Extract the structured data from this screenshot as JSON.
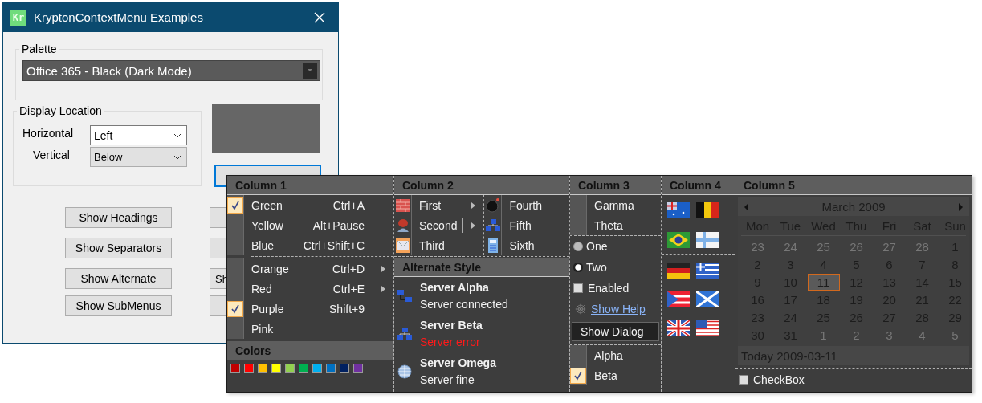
{
  "window": {
    "app_icon_text": "Kr",
    "title": "KryptonContextMenu Examples",
    "palette": {
      "label": "Palette",
      "value": "Office 365 - Black (Dark Mode)"
    },
    "display_location": {
      "label": "Display Location",
      "horizontal": {
        "label": "Horizontal",
        "value": "Left"
      },
      "vertical": {
        "label": "Vertical",
        "value": "Below"
      }
    },
    "left_buttons": [
      "Show Headings",
      "Show Separators",
      "Show Alternate",
      "Show SubMenus"
    ],
    "covered_button_label": "Sh"
  },
  "menu": {
    "column_1": {
      "heading": "Column 1",
      "items": [
        {
          "text": "Green",
          "shortcut": "Ctrl+A",
          "checked": true,
          "submenu": false,
          "separator_before": false
        },
        {
          "text": "Yellow",
          "shortcut": "Alt+Pause",
          "checked": false,
          "submenu": false,
          "separator_before": false
        },
        {
          "text": "Blue",
          "shortcut": "Ctrl+Shift+C",
          "checked": false,
          "submenu": false,
          "separator_before": false
        },
        {
          "text": "Orange",
          "shortcut": "Ctrl+D",
          "checked": false,
          "submenu": true,
          "separator_before": true
        },
        {
          "text": "Red",
          "shortcut": "Ctrl+E",
          "checked": false,
          "submenu": true,
          "separator_before": false
        },
        {
          "text": "Purple",
          "shortcut": "Shift+9",
          "checked": true,
          "submenu": false,
          "separator_before": false
        },
        {
          "text": "Pink",
          "checked": false,
          "submenu": false,
          "separator_before": false
        }
      ],
      "colors_heading": "Colors",
      "colors": [
        {
          "color": "#c00000"
        },
        {
          "color": "#ff0000"
        },
        {
          "color": "#ffc000"
        },
        {
          "color": "#ffff00"
        },
        {
          "color": "#92d050"
        },
        {
          "color": "#00b050"
        },
        {
          "color": "#00b0f0"
        },
        {
          "color": "#0070c0"
        },
        {
          "color": "#002060"
        },
        {
          "color": "#7030a0"
        }
      ]
    },
    "column_2": {
      "heading": "Column 2",
      "items": [
        {
          "text": "First",
          "submenu": true,
          "split": false
        },
        {
          "text": "Second",
          "submenu": true,
          "split": true
        },
        {
          "text": "Third",
          "submenu": false,
          "split": false
        },
        {
          "text": "Fourth",
          "submenu": false,
          "split": false
        },
        {
          "text": "Fifth",
          "submenu": false,
          "split": false
        },
        {
          "text": "Sixth",
          "submenu": false,
          "split": false
        }
      ],
      "alternate_heading": "Alternate Style",
      "servers": [
        {
          "title": "Server Alpha",
          "status": "Server connected",
          "error": false
        },
        {
          "title": "Server Beta",
          "status": "Server error",
          "error": true
        },
        {
          "title": "Server Omega",
          "status": "Server fine",
          "error": false
        }
      ]
    },
    "column_3": {
      "heading": "Column 3",
      "top_items": [
        "Gamma",
        "Theta"
      ],
      "radios": [
        {
          "text": "One",
          "selected": false
        },
        {
          "text": "Two",
          "selected": true
        }
      ],
      "checkbox": {
        "text": "Enabled",
        "checked": false
      },
      "link": "Show Help",
      "dialog_button": "Show Dialog",
      "bottom_items": [
        {
          "text": "Alpha",
          "checked": false
        },
        {
          "text": "Beta",
          "checked": true
        }
      ]
    },
    "column_4": {
      "heading": "Column 4"
    },
    "column_5": {
      "heading": "Column 5",
      "calendar": {
        "month": "March 2009",
        "weekdays": [
          "Mon",
          "Tue",
          "Wed",
          "Thu",
          "Fri",
          "Sat",
          "Sun"
        ],
        "days": [
          {
            "day": "23",
            "other_month": true,
            "selected": false
          },
          {
            "day": "24",
            "other_month": true,
            "selected": false
          },
          {
            "day": "25",
            "other_month": true,
            "selected": false
          },
          {
            "day": "26",
            "other_month": true,
            "selected": false
          },
          {
            "day": "27",
            "other_month": true,
            "selected": false
          },
          {
            "day": "28",
            "other_month": true,
            "selected": false
          },
          {
            "day": "1",
            "other_month": false,
            "selected": false
          },
          {
            "day": "2",
            "other_month": false,
            "selected": false
          },
          {
            "day": "3",
            "other_month": false,
            "selected": false
          },
          {
            "day": "4",
            "other_month": false,
            "selected": false
          },
          {
            "day": "5",
            "other_month": false,
            "selected": false
          },
          {
            "day": "6",
            "other_month": false,
            "selected": false
          },
          {
            "day": "7",
            "other_month": false,
            "selected": false
          },
          {
            "day": "8",
            "other_month": false,
            "selected": false
          },
          {
            "day": "9",
            "other_month": false,
            "selected": false
          },
          {
            "day": "10",
            "other_month": false,
            "selected": false
          },
          {
            "day": "11",
            "other_month": false,
            "selected": true
          },
          {
            "day": "12",
            "other_month": false,
            "selected": false
          },
          {
            "day": "13",
            "other_month": false,
            "selected": false
          },
          {
            "day": "14",
            "other_month": false,
            "selected": false
          },
          {
            "day": "15",
            "other_month": false,
            "selected": false
          },
          {
            "day": "16",
            "other_month": false,
            "selected": false
          },
          {
            "day": "17",
            "other_month": false,
            "selected": false
          },
          {
            "day": "18",
            "other_month": false,
            "selected": false
          },
          {
            "day": "19",
            "other_month": false,
            "selected": false
          },
          {
            "day": "20",
            "other_month": false,
            "selected": false
          },
          {
            "day": "21",
            "other_month": false,
            "selected": false
          },
          {
            "day": "22",
            "other_month": false,
            "selected": false
          },
          {
            "day": "23",
            "other_month": false,
            "selected": false
          },
          {
            "day": "24",
            "other_month": false,
            "selected": false
          },
          {
            "day": "25",
            "other_month": false,
            "selected": false
          },
          {
            "day": "26",
            "other_month": false,
            "selected": false
          },
          {
            "day": "27",
            "other_month": false,
            "selected": false
          },
          {
            "day": "28",
            "other_month": false,
            "selected": false
          },
          {
            "day": "29",
            "other_month": false,
            "selected": false
          },
          {
            "day": "30",
            "other_month": false,
            "selected": false
          },
          {
            "day": "31",
            "other_month": false,
            "selected": false
          },
          {
            "day": "1",
            "other_month": true,
            "selected": false
          },
          {
            "day": "2",
            "other_month": true,
            "selected": false
          },
          {
            "day": "3",
            "other_month": true,
            "selected": false
          },
          {
            "day": "4",
            "other_month": true,
            "selected": false
          },
          {
            "day": "5",
            "other_month": true,
            "selected": false
          }
        ],
        "today": "Today 2009-03-11"
      },
      "checkbox": {
        "text": "CheckBox",
        "checked": false
      }
    }
  }
}
